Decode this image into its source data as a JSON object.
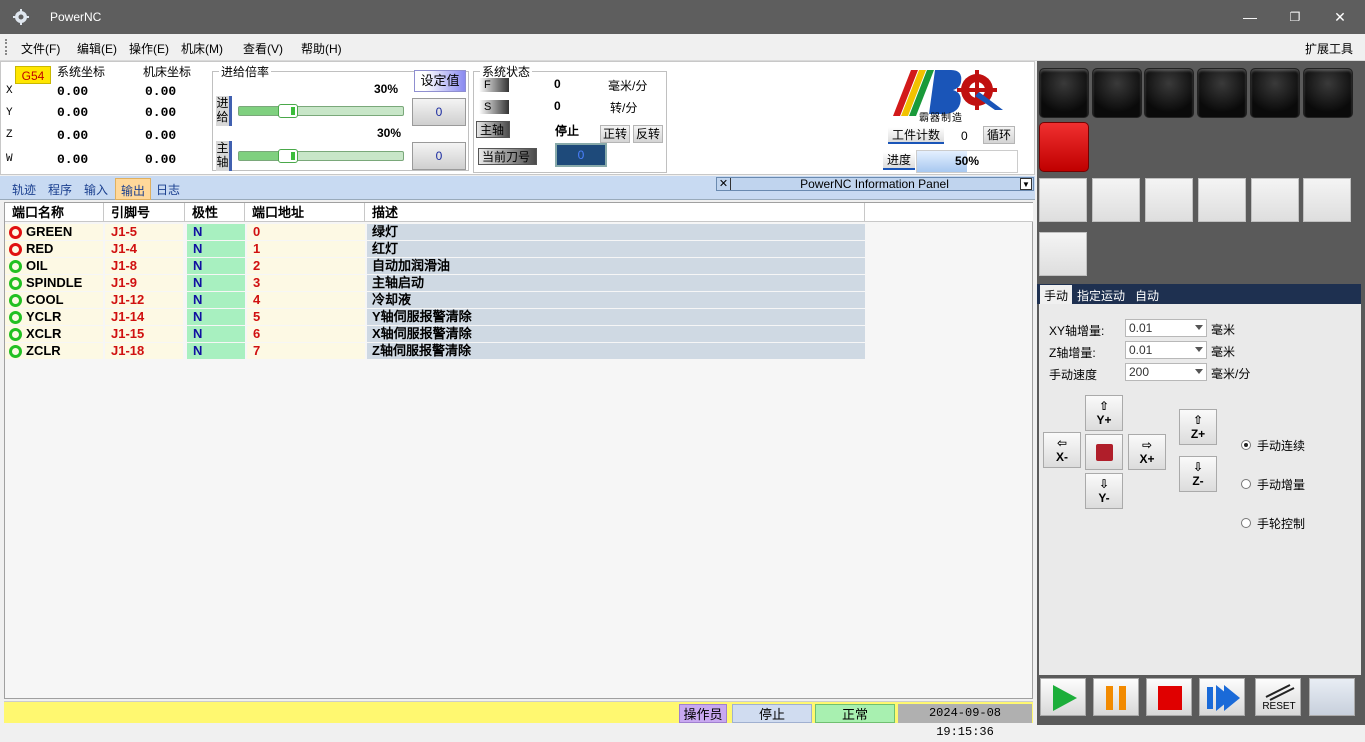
{
  "window": {
    "title": "PowerNC",
    "minimize": "—",
    "restore": "❐",
    "close": "✕"
  },
  "menu": {
    "items": [
      "文件(F)",
      "编辑(E)",
      "操作(E)",
      "机床(M)",
      "查看(V)",
      "帮助(H)"
    ],
    "extension": "扩展工具"
  },
  "coords": {
    "workcoord": "G54",
    "sys_label": "系统坐标",
    "mach_label": "机床坐标",
    "axes": [
      {
        "name": "X",
        "sys": "0.00",
        "mach": "0.00"
      },
      {
        "name": "Y",
        "sys": "0.00",
        "mach": "0.00"
      },
      {
        "name": "Z",
        "sys": "0.00",
        "mach": "0.00"
      },
      {
        "name": "W",
        "sys": "0.00",
        "mach": "0.00"
      }
    ]
  },
  "override": {
    "legend": "进给倍率",
    "set_value_label": "设定值",
    "feed": {
      "label": "进给",
      "percent": "30%",
      "fraction": 0.3,
      "value": "0"
    },
    "spindle": {
      "label": "主轴",
      "percent": "30%",
      "fraction": 0.3,
      "value": "0"
    }
  },
  "sysstatus": {
    "legend": "系统状态",
    "f_label": "F",
    "f_value": "0",
    "f_unit": "毫米/分",
    "s_label": "S",
    "s_value": "0",
    "s_unit": "转/分",
    "spindle_label": "主轴",
    "spindle_state": "停止",
    "forward": "正转",
    "reverse": "反转",
    "tool_label": "当前刀号",
    "tool_value": "0"
  },
  "brand": {
    "logo_text": "霸器制造",
    "work_count_label": "工件计数",
    "work_count": "0",
    "cycle": "循环",
    "progress_label": "进度",
    "progress": "50%",
    "progress_fraction": 0.5
  },
  "tabs": {
    "items": [
      "轨迹",
      "程序",
      "输入",
      "输出",
      "日志"
    ],
    "active": "输出"
  },
  "info_panel": {
    "title": "PowerNC Information Panel",
    "close": "✕",
    "dropdown": "▼"
  },
  "table": {
    "headers": [
      "端口名称",
      "引脚号",
      "极性",
      "端口地址",
      "描述"
    ],
    "rows": [
      {
        "name": "GREEN",
        "pin": "J1-5",
        "pol": "N",
        "addr": "0",
        "desc": "绿灯",
        "state": "red"
      },
      {
        "name": "RED",
        "pin": "J1-4",
        "pol": "N",
        "addr": "1",
        "desc": "红灯",
        "state": "red"
      },
      {
        "name": "OIL",
        "pin": "J1-8",
        "pol": "N",
        "addr": "2",
        "desc": "自动加润滑油",
        "state": "green"
      },
      {
        "name": "SPINDLE",
        "pin": "J1-9",
        "pol": "N",
        "addr": "3",
        "desc": "主轴启动",
        "state": "green"
      },
      {
        "name": "COOL",
        "pin": "J1-12",
        "pol": "N",
        "addr": "4",
        "desc": "冷却液",
        "state": "green"
      },
      {
        "name": "YCLR",
        "pin": "J1-14",
        "pol": "N",
        "addr": "5",
        "desc": "Y轴伺服报警清除",
        "state": "green"
      },
      {
        "name": "XCLR",
        "pin": "J1-15",
        "pol": "N",
        "addr": "6",
        "desc": "X轴伺服报警清除",
        "state": "green"
      },
      {
        "name": "ZCLR",
        "pin": "J1-18",
        "pol": "N",
        "addr": "7",
        "desc": "Z轴伺服报警清除",
        "state": "green"
      }
    ]
  },
  "statusbar": {
    "role": "操作员",
    "run": "停止",
    "health": "正常",
    "datetime": "2024-09-08 19:15:36"
  },
  "right_tabs": {
    "items": [
      "手动",
      "指定运动",
      "自动"
    ],
    "active": "手动"
  },
  "jog": {
    "xy_inc_label": "XY轴增量:",
    "xy_inc_value": "0.01",
    "xy_inc_unit": "毫米",
    "z_inc_label": "Z轴增量:",
    "z_inc_value": "0.01",
    "z_inc_unit": "毫米",
    "speed_label": "手动速度",
    "speed_value": "200",
    "speed_unit": "毫米/分",
    "buttons": {
      "yplus": "Y+",
      "yminus": "Y-",
      "xplus": "X+",
      "xminus": "X-",
      "zplus": "Z+",
      "zminus": "Z-"
    },
    "modes": [
      "手动连续",
      "手动增量",
      "手轮控制"
    ],
    "selected_mode": "手动连续"
  },
  "controls": {
    "reset": "RESET"
  },
  "colors": {
    "status_ok": "#22c022",
    "status_alarm": "#e01010",
    "brand_red": "#c00000"
  }
}
